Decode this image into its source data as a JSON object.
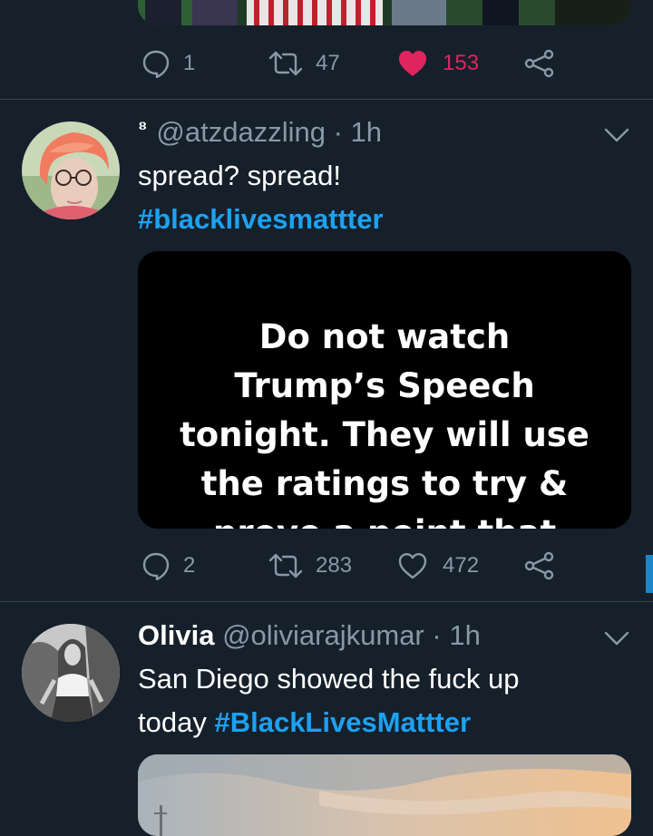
{
  "tweet1": {
    "replies": "1",
    "retweets": "47",
    "likes": "153",
    "liked": true
  },
  "tweet2": {
    "display_name": "⁸",
    "handle": "@atzdazzling",
    "separator": "·",
    "time": "1h",
    "text": "spread? spread!",
    "hashtag": "#blacklivesmattter",
    "image_text": {
      "line1": "Do not watch",
      "line2": "Trump’s Speech",
      "line3": "tonight. They will use",
      "line4": "the ratings to try &",
      "line5": "prove a point that"
    },
    "replies": "2",
    "retweets": "283",
    "likes": "472"
  },
  "tweet3": {
    "display_name": "Olivia",
    "handle": "@oliviarajkumar",
    "separator": "·",
    "time": "1h",
    "text": "San Diego showed the fuck up",
    "text2": "today",
    "hashtag": "#BlackLivesMattter"
  },
  "icons": {
    "reply": "reply-bubble-icon",
    "retweet": "retweet-icon",
    "like": "heart-icon",
    "share": "share-icon",
    "caret": "chevron-down-icon"
  },
  "colors": {
    "background": "#15202b",
    "accent": "#1da1f2",
    "like": "#e0245e",
    "muted": "#8899a6"
  }
}
